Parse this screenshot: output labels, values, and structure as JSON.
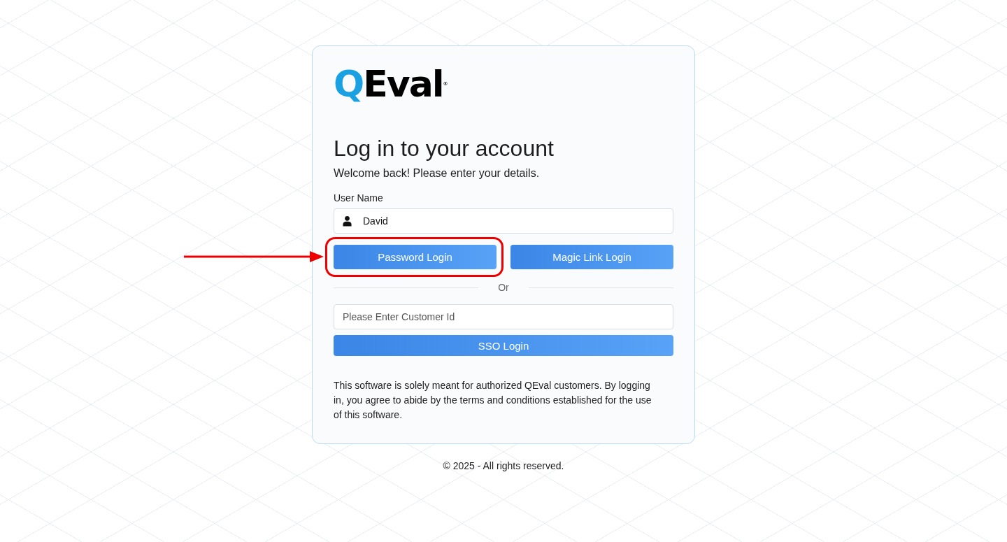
{
  "logo": {
    "mark": "Q",
    "word": "Eval",
    "registered": "®"
  },
  "heading": "Log in to your account",
  "subheading": "Welcome back! Please enter your details.",
  "username": {
    "label": "User Name",
    "value": "David"
  },
  "login_buttons": [
    {
      "label": "Password Login",
      "annotation": {
        "kind": "arrow-ring"
      }
    },
    {
      "label": "Magic Link Login"
    }
  ],
  "divider": "Or",
  "customer_id": {
    "placeholder": "Please Enter Customer Id"
  },
  "sso_button": "SSO Login",
  "disclaimer": "This software is solely meant for authorized QEval customers. By logging in, you agree to abide by the terms and conditions established for the use of this software.",
  "footer": "© 2025 - All rights reserved."
}
